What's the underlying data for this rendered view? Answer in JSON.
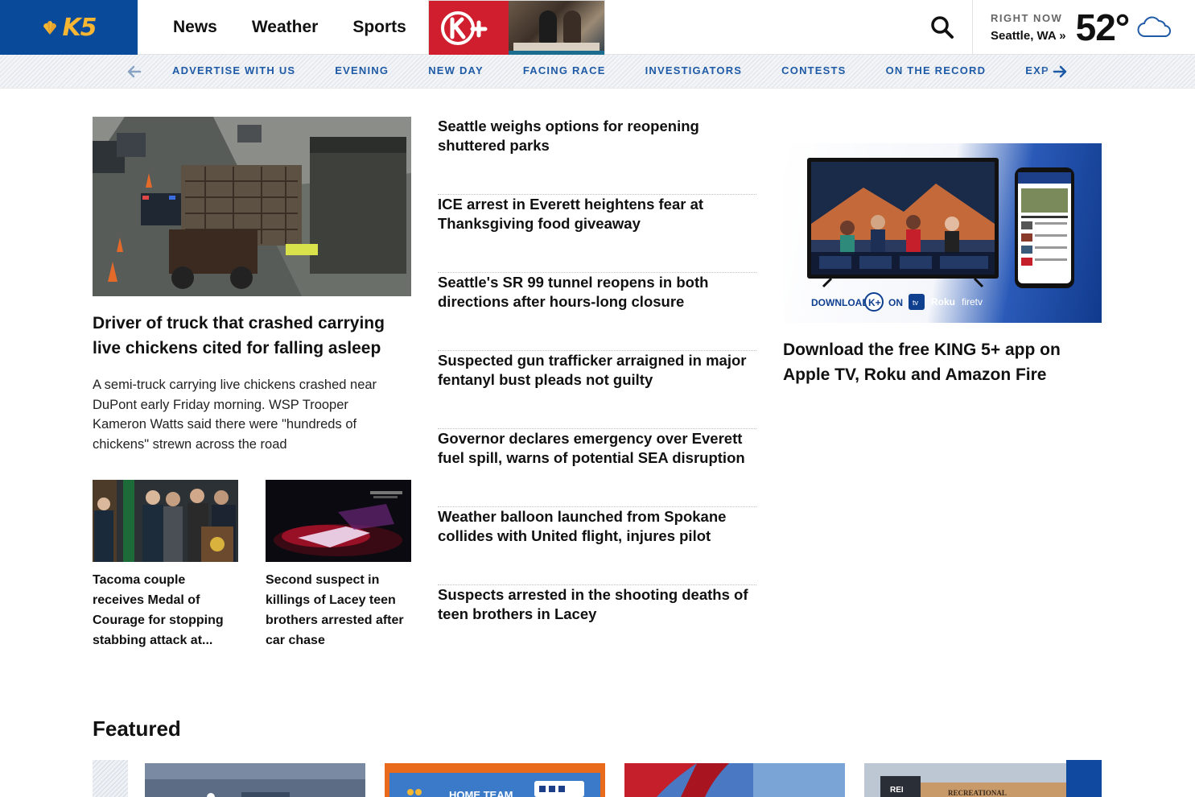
{
  "header": {
    "logo_text": "K5",
    "nav": [
      "News",
      "Weather",
      "Sports"
    ],
    "weather": {
      "right_now_label": "RIGHT NOW",
      "location": "Seattle, WA »",
      "temperature": "52°",
      "condition_icon": "cloud-icon"
    }
  },
  "subnav": {
    "items": [
      "ADVERTISE WITH US",
      "EVENING",
      "NEW DAY",
      "FACING RACE",
      "INVESTIGATORS",
      "CONTESTS",
      "ON THE RECORD",
      "EXPLORE"
    ]
  },
  "lead_story": {
    "title": "Driver of truck that crashed carrying live chickens cited for falling asleep",
    "description": "A semi-truck carrying live chickens crashed near DuPont early Friday morning. WSP Trooper Kameron Watts said there were \"hundreds of chickens\" strewn across the road"
  },
  "small_stories": [
    {
      "title": "Tacoma couple receives Medal of Courage for stopping stabbing attack at..."
    },
    {
      "title": "Second suspect in killings of Lacey teen brothers arrested after car chase"
    }
  ],
  "headlines": [
    "Seattle weighs options for reopening shuttered parks",
    "ICE arrest in Everett heightens fear at Thanksgiving food giveaway",
    "Seattle's SR 99 tunnel reopens in both directions after hours-long closure",
    "Suspected gun trafficker arraigned in major fentanyl bust pleads not guilty",
    "Governor declares emergency over Everett fuel spill, warns of potential SEA disruption",
    "Weather balloon launched from Spokane collides with United flight, injures pilot",
    "Suspects arrested in the shooting deaths of teen brothers in Lacey"
  ],
  "promo": {
    "title": "Download the free KING 5+ app on Apple TV, Roku and Amazon Fire",
    "image_text": {
      "download": "DOWNLOAD",
      "on": "ON",
      "roku": "Roku",
      "firetv": "firetv",
      "appletv": "tv"
    }
  },
  "featured": {
    "heading": "Featured",
    "card_texts": [
      "HOME TEAM",
      "RECREATIONAL"
    ]
  },
  "colors": {
    "brand_blue": "#0a4a9a",
    "brand_gold": "#f7b733",
    "kplus_red": "#d11e2e",
    "subnav_link": "#1f5aa6"
  }
}
